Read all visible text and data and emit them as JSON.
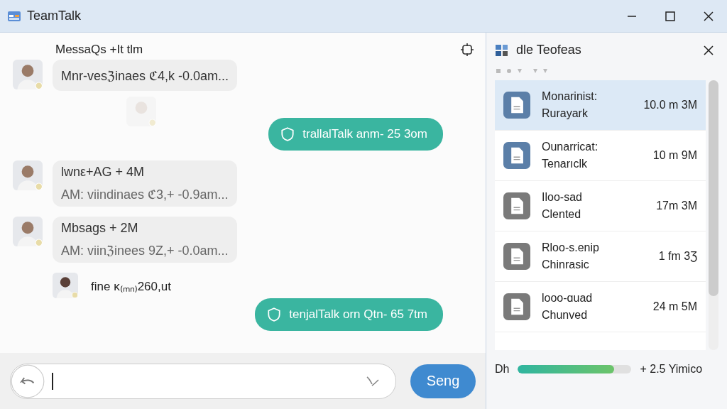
{
  "window": {
    "title": "TeamTalk"
  },
  "chat": {
    "header": "MessaQs +It tlm",
    "messages": [
      {
        "kind": "incoming",
        "lines": [
          "Mnr-vesℨinaes ℭ4,k -0.0am..."
        ]
      },
      {
        "kind": "ghost"
      },
      {
        "kind": "outgoing",
        "text": "trallalTalk anm- 25 3om"
      },
      {
        "kind": "incoming",
        "lines": [
          "lwnε+AG +  4M",
          "AM: viindinaes ℭ3,+ -0.9am..."
        ]
      },
      {
        "kind": "incoming",
        "lines": [
          "Mbsags + 2M",
          "AM: viinℨinees 9Z,+ -0.0am..."
        ]
      },
      {
        "kind": "small",
        "text": "fine κ₍ₘₙ₎260,ut"
      },
      {
        "kind": "outgoing",
        "text": "tenjalTalk orn Qtn- 65 7tm"
      }
    ],
    "send": "Seng"
  },
  "files": {
    "title": "dle Teofeas",
    "items": [
      {
        "name": "Monarinist:",
        "sub": "Rurayark",
        "size": "10.0 m 3M",
        "selected": true,
        "color": "#5b7fa8"
      },
      {
        "name": "Ounarricat:",
        "sub": "Tenarıclk",
        "size": "10 m 9M",
        "selected": false,
        "color": "#5b7fa8"
      },
      {
        "name": "Iloo-sad",
        "sub": "Clented",
        "size": "17m 3M",
        "selected": false,
        "color": "#7a7a7a"
      },
      {
        "name": "Rloo-s.enip",
        "sub": "Chinrasic",
        "size": "1 fm 3Ʒ",
        "selected": false,
        "color": "#7a7a7a"
      },
      {
        "name": "looo-ɑuad",
        "sub": "Chunved",
        "size": "24 m 5M",
        "selected": false,
        "color": "#7a7a7a"
      }
    ],
    "progress": {
      "label": "Dh",
      "level": 0.85,
      "reading": "+ 2.5 Yimico"
    }
  }
}
